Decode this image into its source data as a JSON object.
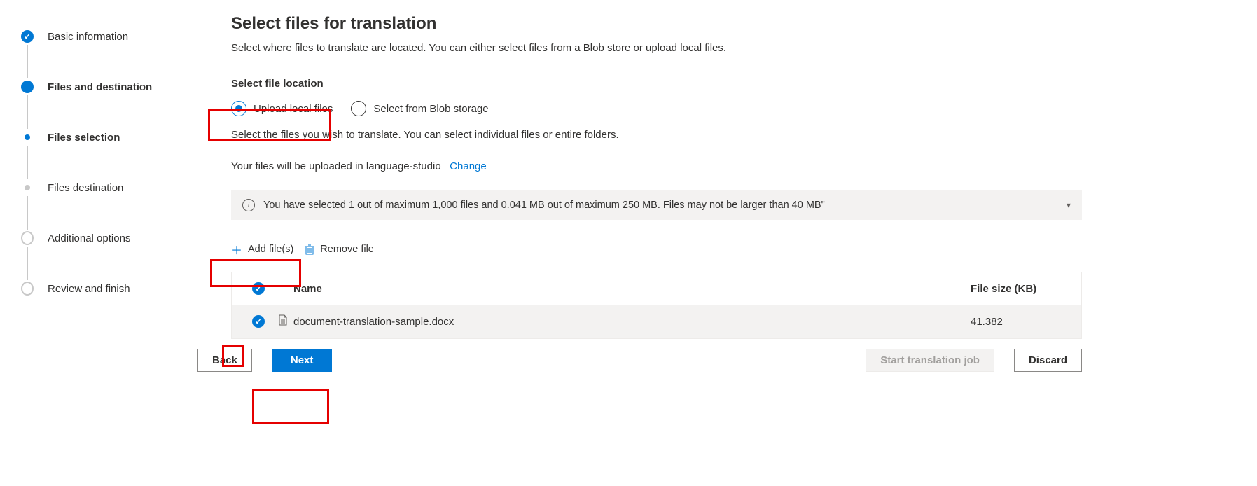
{
  "steps": {
    "s0": "Basic information",
    "s1": "Files and destination",
    "s2": "Files selection",
    "s3": "Files destination",
    "s4": "Additional options",
    "s5": "Review and finish"
  },
  "main": {
    "title": "Select files for translation",
    "description": "Select where files to translate are located. You can either select files from a Blob store or upload local files.",
    "file_location_label": "Select file location",
    "radios": {
      "upload": "Upload local files",
      "blob": "Select from Blob storage"
    },
    "sub_desc": "Select the files you wish to translate. You can select individual files or entire folders.",
    "upload_line_prefix": "Your files will be uploaded in language-studio",
    "change_link": "Change",
    "info_bar": "You have selected 1 out of maximum 1,000 files and 0.041 MB out of maximum 250 MB. Files may not be larger than 40 MB\"",
    "toolbar": {
      "add": "Add file(s)",
      "remove": "Remove file"
    },
    "table": {
      "col_name": "Name",
      "col_size": "File size (KB)",
      "rows": [
        {
          "name": "document-translation-sample.docx",
          "size": "41.382"
        }
      ]
    },
    "buttons": {
      "back": "Back",
      "next": "Next",
      "start": "Start translation job",
      "discard": "Discard"
    }
  }
}
